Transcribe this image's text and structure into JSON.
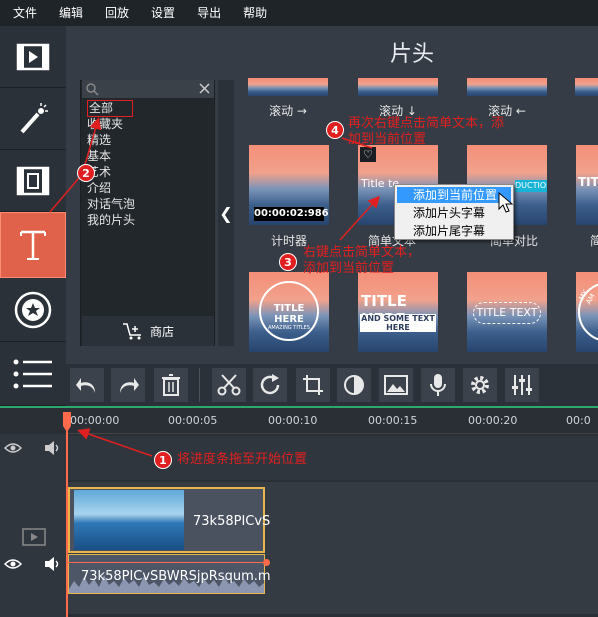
{
  "menubar": {
    "items": [
      "文件",
      "编辑",
      "回放",
      "设置",
      "导出",
      "帮助"
    ]
  },
  "panel": {
    "title": "片头"
  },
  "sidebar": {
    "items": [
      "import-icon",
      "magic-wand-icon",
      "filters-icon",
      "titles-icon",
      "stickers-icon",
      "more-icon"
    ],
    "active": "titles-icon"
  },
  "categories": {
    "items": [
      "全部",
      "收藏夹",
      "精选",
      "基本",
      "艺术",
      "介绍",
      "对话气泡",
      "我的片头"
    ],
    "selected": "全部",
    "store_label": "商店"
  },
  "thumbs": {
    "row1_labels": [
      "滚动 →",
      "滚动 ↓",
      "滚动 ←"
    ],
    "row2_labels": [
      "计时器",
      "简单文本",
      "简单对比",
      "简"
    ],
    "timer": "00:00:02:986",
    "simple_text": "Title te",
    "intro": "DUCTION",
    "tit": "TITL",
    "row3": {
      "a_title": "TITLE HERE",
      "a_sub": "AMAZING TITLES",
      "b_title": "TITLE HERE",
      "b_sub": "AND SOME TEXT HERE",
      "c_title": "TITLE TEXT",
      "d_text": "MY AM"
    }
  },
  "context_menu": {
    "items": [
      "添加到当前位置",
      "添加片头字幕",
      "添加片尾字幕"
    ],
    "highlighted": 0
  },
  "annotations": {
    "a1": "将进度条拖至开始位置",
    "a3_line1": "右键点击简单文本，",
    "a3_line2": "添加到当前位置",
    "a4_line1": "再次右键点击简单文本，添",
    "a4_line2": "加到当前位置",
    "badges": [
      "1",
      "2",
      "3",
      "4"
    ]
  },
  "timeline": {
    "ticks": [
      "00:00:00",
      "00:00:05",
      "00:00:10",
      "00:00:15",
      "00:00:20",
      "00:0"
    ],
    "video_clip": "73k58PICvS",
    "audio_clip": "73k58PICvSBWRSjpRsqum.m"
  },
  "colors": {
    "accent": "#e0624a",
    "annotation": "#e02020",
    "playhead": "#ff6a4a"
  }
}
